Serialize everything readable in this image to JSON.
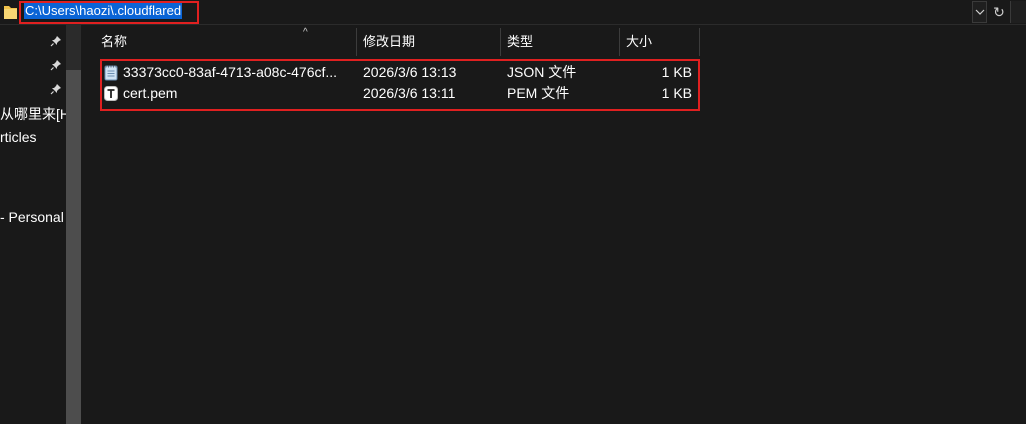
{
  "address_bar": {
    "path": "C:\\Users\\haozi\\.cloudflared",
    "dropdown_icon": "chevron-down-icon",
    "refresh_label": "↻",
    "refresh_icon": "refresh-icon"
  },
  "nav_pane": {
    "items": [
      {
        "label": "从哪里来[H"
      },
      {
        "label": "rticles"
      },
      {
        "label": "- Personal"
      }
    ]
  },
  "file_list": {
    "sort_indicator": "^",
    "columns": [
      {
        "label": "名称"
      },
      {
        "label": "修改日期"
      },
      {
        "label": "类型"
      },
      {
        "label": "大小"
      }
    ],
    "rows": [
      {
        "name": "33373cc0-83af-4713-a08c-476cf...",
        "date": "2026/3/6 13:13",
        "type": "JSON 文件",
        "size": "1 KB",
        "icon": "notepad-file-icon"
      },
      {
        "name": "cert.pem",
        "date": "2026/3/6 13:11",
        "type": "PEM 文件",
        "size": "1 KB",
        "icon": "text-file-icon"
      }
    ]
  },
  "colors": {
    "background": "#191919",
    "selection": "#0a64d6",
    "highlight_border": "#e02020",
    "folder": "#f0c24b"
  }
}
